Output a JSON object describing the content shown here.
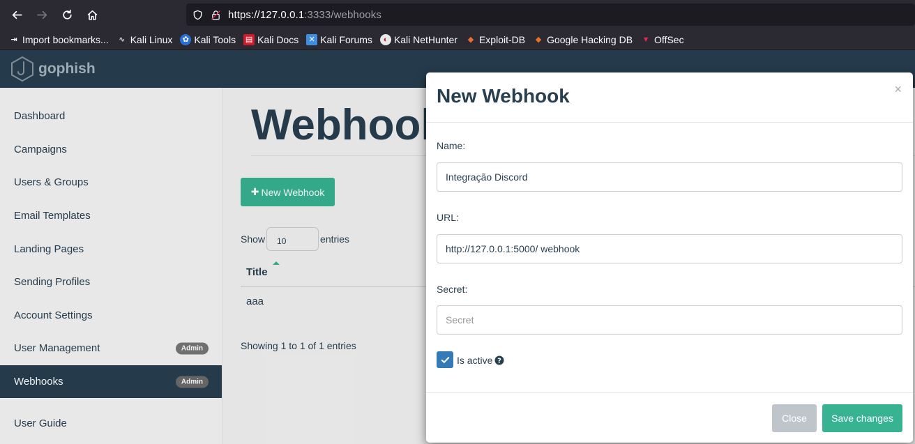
{
  "browser": {
    "url_host": "https://127.0.0.1",
    "url_rest": ":3333/webhooks",
    "bookmarks": [
      {
        "label": "Import bookmarks...",
        "icon": "import-icon"
      },
      {
        "label": "Kali Linux",
        "icon": "kali-dragon-icon"
      },
      {
        "label": "Kali Tools",
        "icon": "kali-tools-icon"
      },
      {
        "label": "Kali Docs",
        "icon": "kali-docs-icon"
      },
      {
        "label": "Kali Forums",
        "icon": "kali-forums-icon"
      },
      {
        "label": "Kali NetHunter",
        "icon": "kali-nethunter-icon"
      },
      {
        "label": "Exploit-DB",
        "icon": "exploit-db-icon"
      },
      {
        "label": "Google Hacking DB",
        "icon": "ghdb-icon"
      },
      {
        "label": "OffSec",
        "icon": "offsec-icon"
      }
    ]
  },
  "app": {
    "brand": "gophish",
    "sidebar": [
      {
        "label": "Dashboard",
        "badge": ""
      },
      {
        "label": "Campaigns",
        "badge": ""
      },
      {
        "label": "Users & Groups",
        "badge": ""
      },
      {
        "label": "Email Templates",
        "badge": ""
      },
      {
        "label": "Landing Pages",
        "badge": ""
      },
      {
        "label": "Sending Profiles",
        "badge": ""
      },
      {
        "label": "Account Settings",
        "badge": ""
      },
      {
        "label": "User Management",
        "badge": "Admin"
      },
      {
        "label": "Webhooks",
        "badge": "Admin"
      },
      {
        "label": "User Guide",
        "badge": ""
      }
    ],
    "page_title": "Webhooks",
    "new_button": "New Webhook",
    "show_label": "Show",
    "entries_value": "10",
    "entries_label": "entries",
    "table": {
      "headers": [
        "Title"
      ],
      "rows": [
        [
          "aaa"
        ]
      ]
    },
    "showing_text": "Showing 1 to 1 of 1 entries"
  },
  "modal": {
    "title": "New Webhook",
    "close_symbol": "×",
    "name_label": "Name:",
    "name_value": "Integração Discord",
    "url_label": "URL:",
    "url_value": "http://127.0.0.1:5000/ webhook",
    "secret_label": "Secret:",
    "secret_placeholder": "Secret",
    "active_label": "Is active",
    "active_checked": true,
    "close_button": "Close",
    "save_button": "Save changes"
  },
  "colors": {
    "navbar": "#283f50",
    "accent": "#37b392",
    "checkbox": "#337ab7"
  }
}
